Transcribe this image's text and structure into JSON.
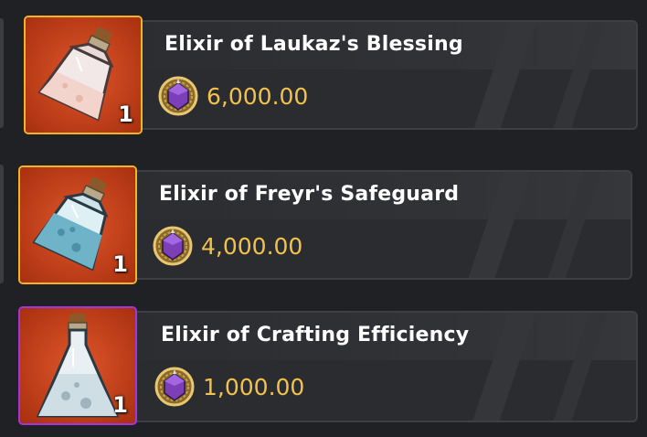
{
  "items": [
    {
      "name": "Elixir of Laukaz's Blessing",
      "price": "6,000.00",
      "quantity": "1",
      "icon": "pink-elixir-icon",
      "rarity_border": "#f0b429",
      "bg_color": "#c7451a"
    },
    {
      "name": "Elixir of Freyr's Safeguard",
      "price": "4,000.00",
      "quantity": "1",
      "icon": "blue-elixir-icon",
      "rarity_border": "#f0b429",
      "bg_color": "#c7451a"
    },
    {
      "name": "Elixir of Crafting Efficiency",
      "price": "1,000.00",
      "quantity": "1",
      "icon": "white-elixir-icon",
      "rarity_border": "#a335e0",
      "bg_color": "#c7451a"
    }
  ],
  "currency_icon": "purple-gem-coin-icon",
  "colors": {
    "price": "#f2c14e",
    "title": "#ffffff",
    "panel_bg": "#2a2c2f",
    "page_bg": "#202124"
  }
}
